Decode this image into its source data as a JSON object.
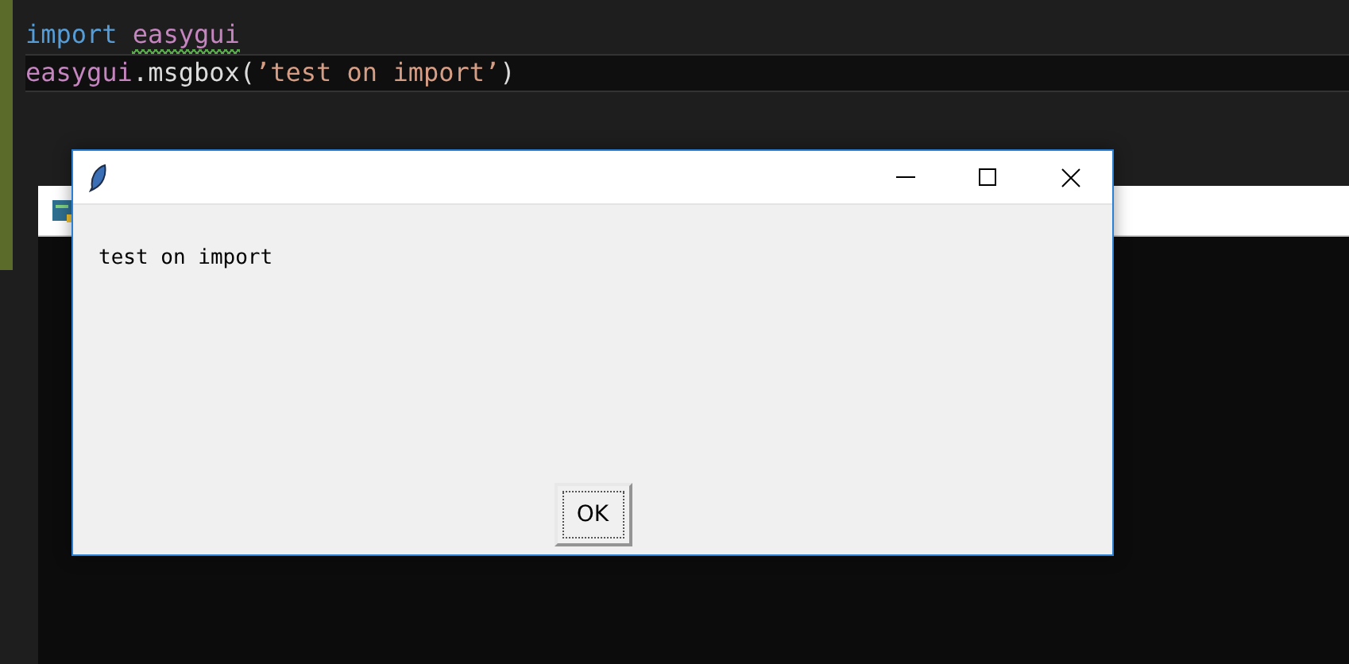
{
  "editor": {
    "lines": [
      {
        "current": false,
        "tokens": [
          {
            "text": "import",
            "kind": "keyword",
            "warning": false
          },
          {
            "text": "easygui",
            "kind": "module",
            "warning": true,
            "space_before": true
          }
        ]
      },
      {
        "current": true,
        "tokens": [
          {
            "text": "easygui",
            "kind": "module",
            "warning": false
          },
          {
            "text": ".msgbox(",
            "kind": "plain",
            "warning": false
          },
          {
            "text": "’test on import’",
            "kind": "string",
            "warning": false
          },
          {
            "text": ")",
            "kind": "plain",
            "warning": false
          }
        ]
      }
    ]
  },
  "dialog": {
    "message": "test on import",
    "button": "OK",
    "button_focused": true
  }
}
